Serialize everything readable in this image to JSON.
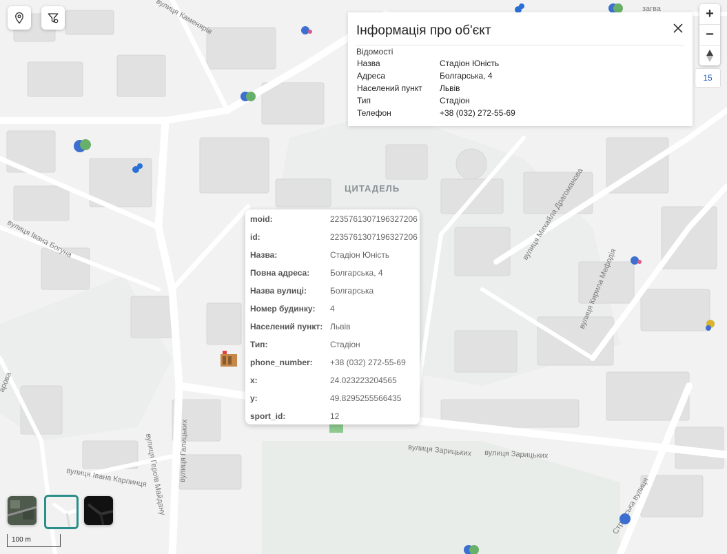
{
  "map": {
    "district_label": "ЦИТАДЕЛЬ",
    "street_labels": [
      "вулиця Каменярів",
      "вулиця Івана Богуна",
      "вулиця Героїв Майдану",
      "вулиця Галицьких",
      "вулиця Івана Карпинця",
      "вулиця Зарицьких",
      "вулиця Зарицьких",
      "вулиця Михайла Драгоманова",
      "вулиця Кирила Мефодія",
      "Стрийська вулиця",
      "арова",
      "загва"
    ],
    "icons": [
      "sport-people-icon",
      "swimmer-icon",
      "stadium-icon",
      "dancer-icon",
      "park-icon"
    ]
  },
  "toolbar": {
    "location_tooltip": "location",
    "filter_tooltip": "filter"
  },
  "zoom": {
    "in_label": "+",
    "out_label": "−",
    "compass_label": "▲",
    "level": "15"
  },
  "info_panel": {
    "title": "Інформація про об'єкт",
    "close_label": "×",
    "section": "Відомості",
    "rows": [
      {
        "key": "Назва",
        "value": "Стадіон Юність"
      },
      {
        "key": "Адреса",
        "value": "Болгарська, 4"
      },
      {
        "key": "Населений пункт",
        "value": "Львів"
      },
      {
        "key": "Тип",
        "value": "Стадіон"
      },
      {
        "key": "Телефон",
        "value": "+38 (032) 272-55-69"
      }
    ]
  },
  "popup": {
    "rows": [
      {
        "key": "moid:",
        "value": "2235761307196327206"
      },
      {
        "key": "id:",
        "value": "2235761307196327206"
      },
      {
        "key": "Назва:",
        "value": "Стадіон Юність"
      },
      {
        "key": "Повна адреса:",
        "value": "Болгарська, 4"
      },
      {
        "key": "Назва вулиці:",
        "value": "Болгарська"
      },
      {
        "key": "Номер будинку:",
        "value": "4"
      },
      {
        "key": "Населений пункт:",
        "value": "Львів"
      },
      {
        "key": "Тип:",
        "value": "Стадіон"
      },
      {
        "key": "phone_number:",
        "value": "+38 (032) 272-55-69"
      },
      {
        "key": "x:",
        "value": "24.023223204565"
      },
      {
        "key": "y:",
        "value": "49.8295255566435"
      },
      {
        "key": "sport_id:",
        "value": "12"
      }
    ]
  },
  "basemaps": [
    "satellite",
    "light",
    "dark"
  ],
  "scale": {
    "label": "100 m"
  },
  "colors": {
    "accent": "#2a8f8a",
    "land": "#f3f3f3",
    "building": "#e2e2e2",
    "park": "#e8ece9"
  }
}
